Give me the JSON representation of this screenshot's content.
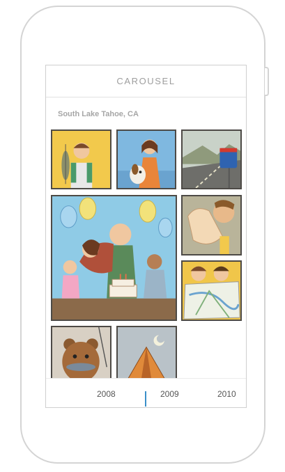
{
  "app": {
    "title": "CAROUSEL"
  },
  "album": {
    "location": "South Lake Tahoe, CA"
  },
  "photos": [
    {
      "subject": "fishing",
      "color": "#f2c94c"
    },
    {
      "subject": "woman-with-dog",
      "color": "#7fb8e0"
    },
    {
      "subject": "road-trip-highway",
      "color": "#9aa58f"
    },
    {
      "subject": "birthday-party",
      "color": "#8fcbe6"
    },
    {
      "subject": "waving-hand",
      "color": "#f3d9b6"
    },
    {
      "subject": "kids-with-map",
      "color": "#f0c64a"
    },
    {
      "subject": "bear-with-fish",
      "color": "#d8d0c4"
    },
    {
      "subject": "camping-tent",
      "color": "#b9c2c8"
    }
  ],
  "timeline": {
    "years": [
      "2008",
      "2009",
      "2010"
    ],
    "selected": "2009"
  },
  "colors": {
    "accent": "#3a8fc9",
    "frame": "#d4d4d4",
    "tile_border": "#4d4a46"
  }
}
